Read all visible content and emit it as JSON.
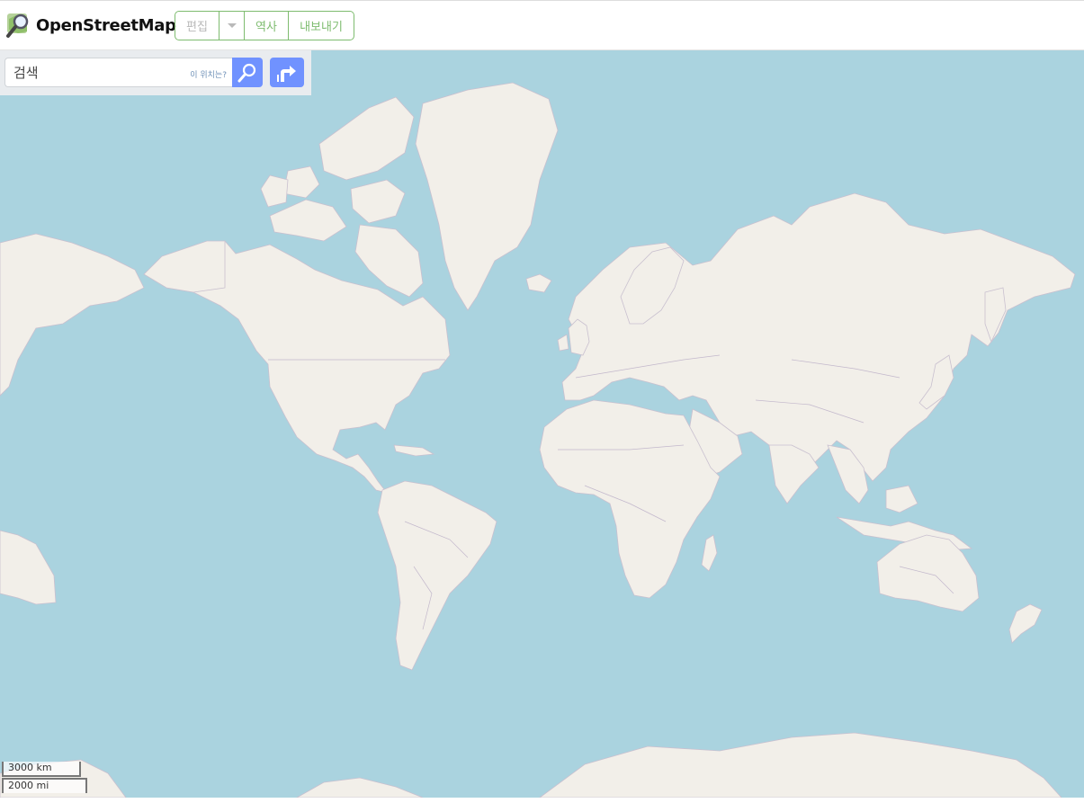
{
  "app": {
    "brand": "OpenStreetMap"
  },
  "nav": {
    "edit_label": "편집",
    "history_label": "역사",
    "export_label": "내보내기"
  },
  "search": {
    "placeholder": "검색",
    "where_label": "이 위치는?"
  },
  "scale": {
    "metric": "3000 km",
    "imperial": "2000 mi"
  },
  "colors": {
    "water": "#aad3df",
    "land": "#f2efe9",
    "accent": "#7ebc6f",
    "button": "#7092ff"
  },
  "icons": {
    "logo": "magnifier-map-icon",
    "search": "search-icon",
    "directions": "directions-icon",
    "dropdown": "caret-down-icon"
  }
}
